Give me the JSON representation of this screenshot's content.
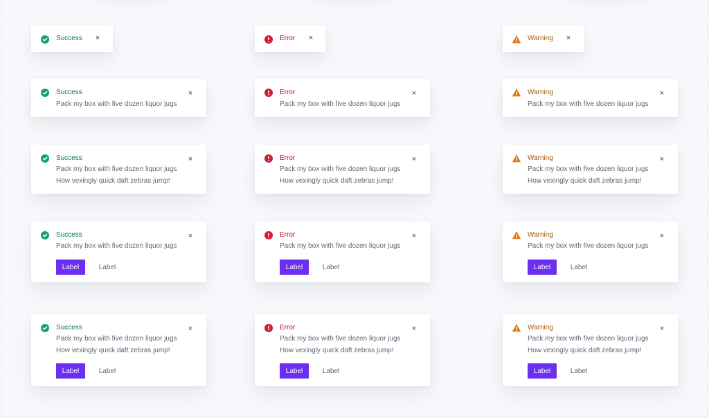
{
  "colors": {
    "success": "#0f9f7a",
    "error": "#d11a3a",
    "warning": "#e07b14",
    "primary": "#6b2ff0"
  },
  "icons": {
    "success": "check-circle-icon",
    "error": "exclamation-circle-icon",
    "warning": "warning-triangle-icon",
    "close": "close-icon"
  },
  "close_glyph": "×",
  "variants": [
    {
      "title": "Success"
    },
    {
      "title": "Error"
    },
    {
      "title": "Warning"
    }
  ],
  "message1": "Pack my box with five dozen liquor jugs",
  "message2": "How vexingly quick daft zebras jump!",
  "primary_label": "Label",
  "secondary_label": "Label"
}
